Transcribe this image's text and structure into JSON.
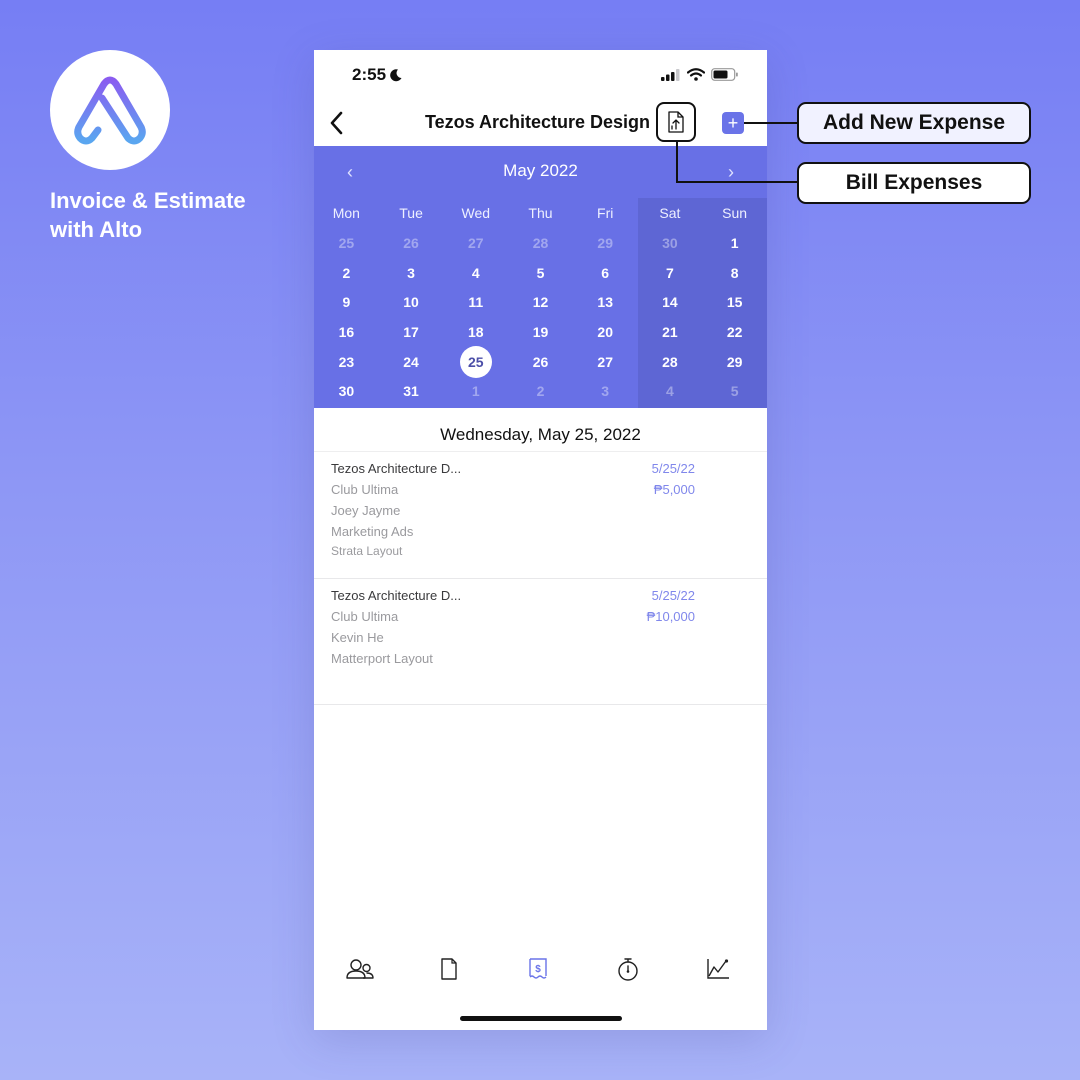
{
  "brand": {
    "logo_icon": "alto-logo-icon",
    "title_line1": "Invoice & Estimate",
    "title_line2": "with Alto"
  },
  "status_bar": {
    "time": "2:55",
    "focus_icon": "moon-icon",
    "icons": [
      "signal-icon",
      "wifi-icon",
      "battery-icon"
    ]
  },
  "nav": {
    "back_icon": "chevron-left-icon",
    "title": "Tezos Architecture Design",
    "bill_icon": "document-upload-icon",
    "add_icon": "plus-icon",
    "add_label": "+"
  },
  "calendar": {
    "month_label": "May 2022",
    "prev_label": "‹",
    "next_label": "›",
    "weekdays": [
      "Mon",
      "Tue",
      "Wed",
      "Thu",
      "Fri",
      "Sat",
      "Sun"
    ],
    "selected_day": "25",
    "weeks": [
      [
        {
          "d": "25",
          "m": true
        },
        {
          "d": "26",
          "m": true
        },
        {
          "d": "27",
          "m": true
        },
        {
          "d": "28",
          "m": true
        },
        {
          "d": "29",
          "m": true
        },
        {
          "d": "30",
          "m": true
        },
        {
          "d": "1",
          "m": false
        }
      ],
      [
        {
          "d": "2",
          "m": false
        },
        {
          "d": "3",
          "m": false
        },
        {
          "d": "4",
          "m": false
        },
        {
          "d": "5",
          "m": false
        },
        {
          "d": "6",
          "m": false
        },
        {
          "d": "7",
          "m": false
        },
        {
          "d": "8",
          "m": false
        }
      ],
      [
        {
          "d": "9",
          "m": false
        },
        {
          "d": "10",
          "m": false
        },
        {
          "d": "11",
          "m": false
        },
        {
          "d": "12",
          "m": false
        },
        {
          "d": "13",
          "m": false
        },
        {
          "d": "14",
          "m": false
        },
        {
          "d": "15",
          "m": false
        }
      ],
      [
        {
          "d": "16",
          "m": false
        },
        {
          "d": "17",
          "m": false
        },
        {
          "d": "18",
          "m": false
        },
        {
          "d": "19",
          "m": false
        },
        {
          "d": "20",
          "m": false
        },
        {
          "d": "21",
          "m": false
        },
        {
          "d": "22",
          "m": false
        }
      ],
      [
        {
          "d": "23",
          "m": false
        },
        {
          "d": "24",
          "m": false
        },
        {
          "d": "25",
          "m": false
        },
        {
          "d": "26",
          "m": false
        },
        {
          "d": "27",
          "m": false
        },
        {
          "d": "28",
          "m": false
        },
        {
          "d": "29",
          "m": false
        }
      ],
      [
        {
          "d": "30",
          "m": false
        },
        {
          "d": "31",
          "m": false
        },
        {
          "d": "1",
          "m": true
        },
        {
          "d": "2",
          "m": true
        },
        {
          "d": "3",
          "m": true
        },
        {
          "d": "4",
          "m": true
        },
        {
          "d": "5",
          "m": true
        }
      ]
    ]
  },
  "day_heading": "Wednesday, May 25, 2022",
  "expenses": [
    {
      "project": "Tezos Architecture D...",
      "client": "Club Ultima",
      "person": "Joey Jayme",
      "category": "Marketing Ads",
      "note": "Strata Layout",
      "date": "5/25/22",
      "amount": "₱5,000"
    },
    {
      "project": "Tezos Architecture D...",
      "client": "Club Ultima",
      "person": "Kevin He",
      "category": "Matterport Layout",
      "date": "5/25/22",
      "amount": "₱10,000"
    }
  ],
  "tab_bar": [
    {
      "icon": "clients-icon",
      "active": false
    },
    {
      "icon": "document-icon",
      "active": false
    },
    {
      "icon": "expense-receipt-icon",
      "active": true
    },
    {
      "icon": "stopwatch-icon",
      "active": false
    },
    {
      "icon": "chart-line-icon",
      "active": false
    }
  ],
  "callouts": {
    "add": "Add New Expense",
    "bill": "Bill Expenses"
  },
  "colors": {
    "accent": "#6a73e8",
    "calendar_bg": "#6870e6",
    "weekend_bg": "#5e66d4",
    "bg_top": "#767ef4",
    "bg_bottom": "#a8b3f8"
  }
}
